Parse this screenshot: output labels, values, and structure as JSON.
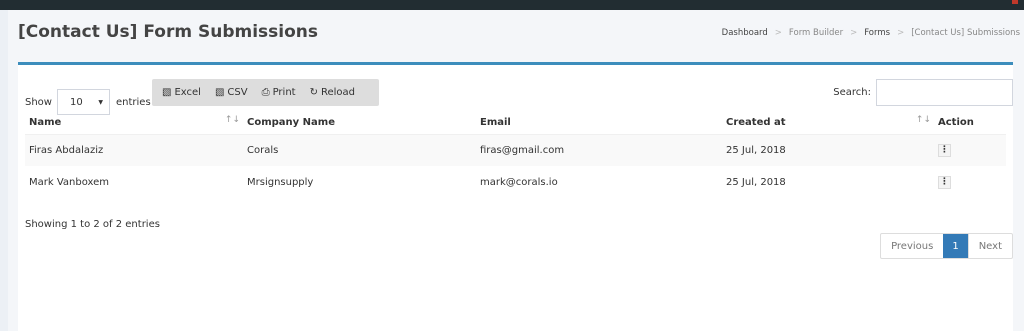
{
  "page": {
    "title": "[Contact Us] Form Submissions"
  },
  "breadcrumb": [
    "Dashboard",
    "Form Builder",
    "Forms",
    "[Contact Us] Submissions"
  ],
  "length_menu": {
    "show_label": "Show",
    "value": "10",
    "entries_label": "entries"
  },
  "buttons": [
    {
      "label": "Excel",
      "icon": "excel-file-icon"
    },
    {
      "label": "CSV",
      "icon": "csv-file-icon"
    },
    {
      "label": "Print",
      "icon": "printer-icon"
    },
    {
      "label": "Reload",
      "icon": "refresh-icon"
    }
  ],
  "search": {
    "label": "Search:",
    "value": ""
  },
  "table": {
    "columns": [
      "Name",
      "Company Name",
      "Email",
      "Created at",
      "Action"
    ],
    "rows": [
      [
        "Firas Abdalaziz",
        "Corals",
        "firas@gmail.com",
        "25 Jul, 2018"
      ],
      [
        "Mark Vanboxem",
        "Mrsignsupply",
        "mark@corals.io",
        "25 Jul, 2018"
      ]
    ]
  },
  "info": "Showing 1 to 2 of 2 entries",
  "pagination": {
    "previous": "Previous",
    "current": "1",
    "next": "Next"
  },
  "colors": {
    "accent": "#3c8dbc",
    "active_page": "#337ab7",
    "topbar": "#222d32"
  }
}
